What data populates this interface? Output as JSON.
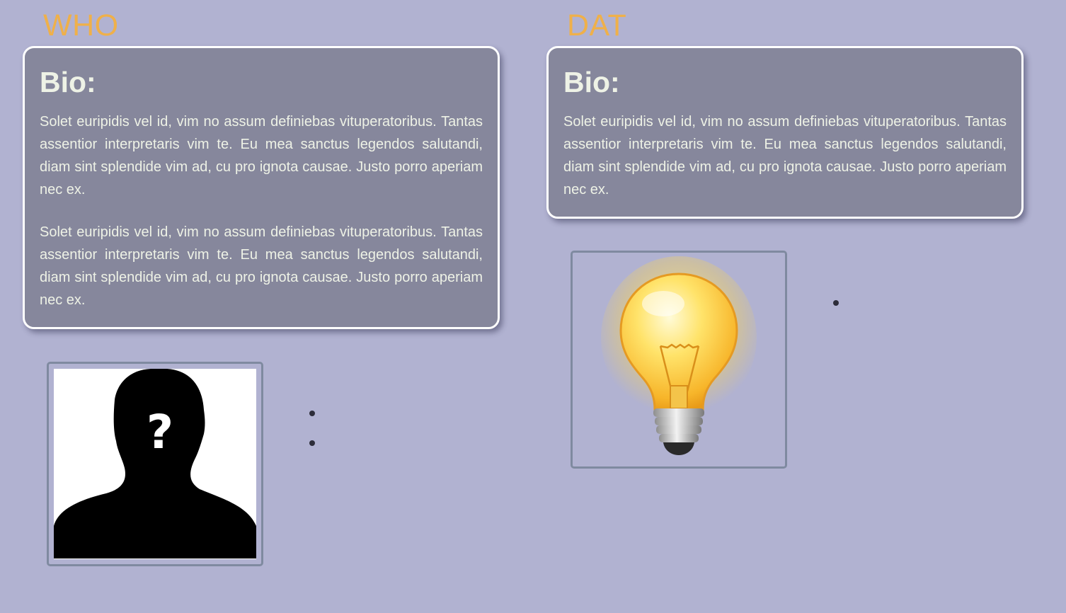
{
  "columns": [
    {
      "title": "WHO",
      "bio_heading": "Bio:",
      "paragraphs": [
        "Solet euripidis vel id, vim no assum definiebas vituperatoribus. Tantas assentior interpretaris vim te. Eu mea sanctus legendos salutandi, diam sint splendide vim ad, cu pro ignota causae. Justo porro aperiam nec ex.",
        "Solet euripidis vel id, vim no assum definiebas vituperatoribus. Tantas assentior interpretaris vim te. Eu mea sanctus legendos salutandi, diam sint splendide vim ad, cu pro ignota causae. Justo porro aperiam nec ex."
      ],
      "image_icon": "unknown-person-silhouette-icon",
      "image_glyph": "?",
      "list_item_count": 2
    },
    {
      "title": "DAT",
      "bio_heading": "Bio:",
      "paragraphs": [
        "Solet euripidis vel id, vim no assum definiebas vituperatoribus. Tantas assentior interpretaris vim te. Eu mea sanctus legendos salutandi, diam sint splendide vim ad, cu pro ignota causae. Justo porro aperiam nec ex."
      ],
      "image_icon": "lightbulb-icon",
      "list_item_count": 1
    }
  ],
  "colors": {
    "background": "#b1b2d1",
    "title": "#efb04a",
    "card_background": "#86879c",
    "card_border": "#ffffff",
    "card_text": "#eef2e6",
    "frame_border": "#7f8aa0"
  }
}
